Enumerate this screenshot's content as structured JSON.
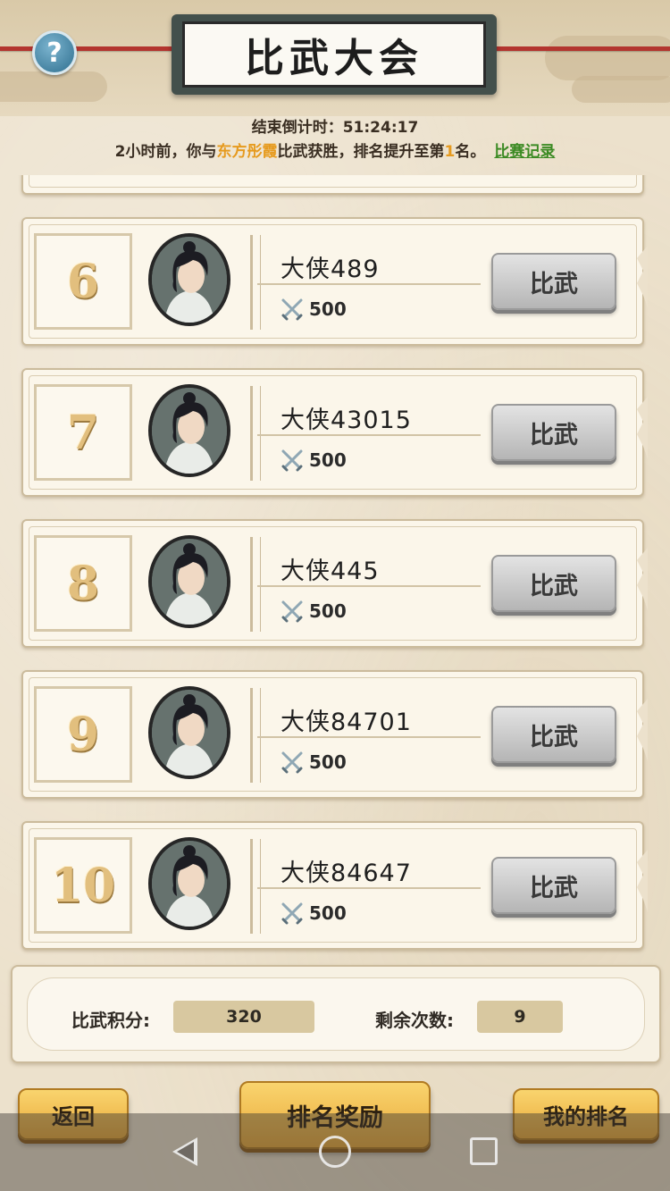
{
  "header": {
    "title": "比武大会",
    "help_symbol": "?"
  },
  "info": {
    "countdown_label": "结束倒计时：",
    "countdown_value": "51:24:17",
    "message_prefix": "2小时前，你与",
    "opponent_name": "东方彤霞",
    "message_middle": "比武获胜，排名提升至第",
    "rank_value": "1",
    "message_suffix": "名。",
    "record_link": "比赛记录"
  },
  "players": [
    {
      "rank": "6",
      "name": "大侠489",
      "power": "500",
      "button": "比武"
    },
    {
      "rank": "7",
      "name": "大侠43015",
      "power": "500",
      "button": "比武"
    },
    {
      "rank": "8",
      "name": "大侠445",
      "power": "500",
      "button": "比武"
    },
    {
      "rank": "9",
      "name": "大侠84701",
      "power": "500",
      "button": "比武"
    },
    {
      "rank": "10",
      "name": "大侠84647",
      "power": "500",
      "button": "比武"
    }
  ],
  "stats": {
    "points_label": "比武积分:",
    "points_value": "320",
    "remaining_label": "剩余次数:",
    "remaining_value": "9"
  },
  "bottom": {
    "back_label": "返回",
    "rewards_label": "排名奖励",
    "my_rank_label": "我的排名"
  },
  "icons": {
    "help": "question-icon",
    "power": "crossed-swords-icon",
    "nav_back": "back-triangle-icon",
    "nav_home": "home-circle-icon",
    "nav_recent": "recent-square-icon"
  },
  "colors": {
    "accent_orange": "#e69a1e",
    "link_green": "#3b8a23",
    "rope_red": "#b3352f",
    "button_gold": "#f9d46e",
    "rank_gold": "#e2bf7e"
  }
}
